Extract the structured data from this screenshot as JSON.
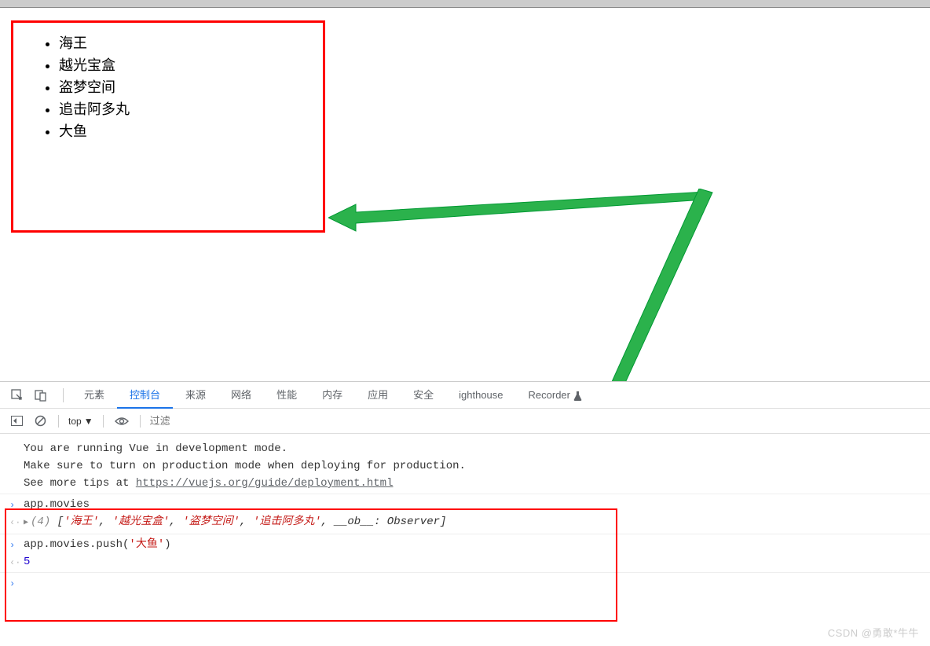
{
  "movies": [
    "海王",
    "越光宝盒",
    "盗梦空间",
    "追击阿多丸",
    "大鱼"
  ],
  "devtools": {
    "tabs": [
      "元素",
      "控制台",
      "来源",
      "网络",
      "性能",
      "内存",
      "应用",
      "安全",
      "ighthouse",
      "Recorder"
    ],
    "active_tab": "控制台",
    "top_selector": "top",
    "filter_placeholder": "过滤",
    "info_lines": [
      "You are running Vue in development mode.",
      "Make sure to turn on production mode when deploying for production.",
      "See more tips at "
    ],
    "info_link": "https://vuejs.org/guide/deployment.html",
    "cmd1": "app.movies",
    "out1_count": "(4)",
    "out1_items": [
      "'海王'",
      "'越光宝盒'",
      "'盗梦空间'",
      "'追击阿多丸'"
    ],
    "out1_tail_key": "__ob__",
    "out1_tail_val": "Observer",
    "cmd2_pre": "app.movies.push(",
    "cmd2_arg": "'大鱼'",
    "cmd2_post": ")",
    "out2": "5"
  },
  "watermark": "CSDN @勇敢*牛牛"
}
